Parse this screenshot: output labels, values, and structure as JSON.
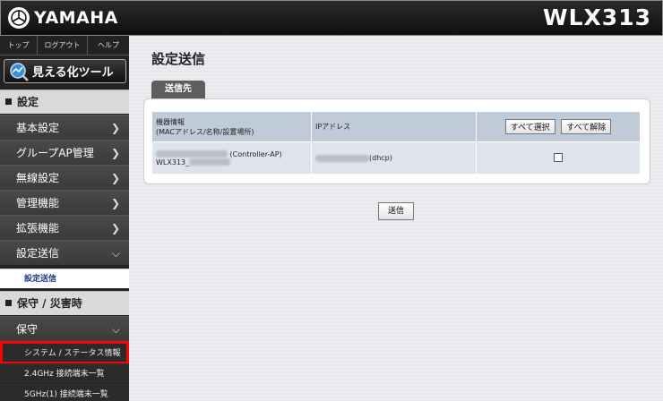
{
  "header": {
    "brand": "YAMAHA",
    "model": "WLX313"
  },
  "sidebar": {
    "topnav": [
      "トップ",
      "ログアウト",
      "ヘルプ"
    ],
    "visual_tool": "見える化ツール",
    "section_settings": "設定",
    "items": [
      {
        "label": "基本設定",
        "arrow": ">"
      },
      {
        "label": "グループAP管理",
        "arrow": ">"
      },
      {
        "label": "無線設定",
        "arrow": ">"
      },
      {
        "label": "管理機能",
        "arrow": ">"
      },
      {
        "label": "拡張機能",
        "arrow": ">"
      },
      {
        "label": "設定送信",
        "arrow": "v"
      }
    ],
    "sub_send": "設定送信",
    "section_maintenance": "保守 / 災害時",
    "maintenance_item": {
      "label": "保守",
      "arrow": "v"
    },
    "sub_items": [
      "システム / ステータス情報",
      "2.4GHz 接続端末一覧",
      "5GHz(1) 接続端末一覧"
    ]
  },
  "main": {
    "title": "設定送信",
    "tab": "送信先",
    "table": {
      "col1": "機器情報",
      "col1_sub": "(MACアドレス/名称/設置場所)",
      "col2": "IPアドレス",
      "select_all": "すべて選択",
      "deselect_all": "すべて解除",
      "row": {
        "device_suffix": "(Controller-AP)",
        "device_name": "WLX313_",
        "ip_suffix": "(dhcp)"
      }
    },
    "send_button": "送信"
  },
  "colors": {
    "header_bg": "#1a1a1a",
    "highlight": "#ff0000",
    "active_link": "#1a3c8a"
  }
}
